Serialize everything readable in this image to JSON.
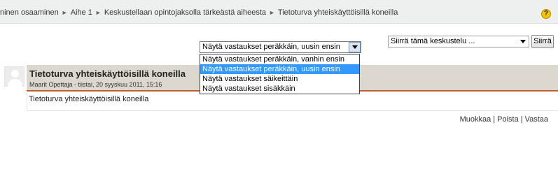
{
  "breadcrumb": {
    "items": [
      "ninen osaaminen",
      "Aihe 1",
      "Keskustellaan opintojaksolla tärkeästä aiheesta",
      "Tietoturva yhteiskäyttöisillä koneilla"
    ],
    "separator": "►"
  },
  "help_icon": "?",
  "display_mode": {
    "selected": "Näytä vastaukset peräkkäin, uusin ensin",
    "options": [
      "Näytä vastaukset peräkkäin, vanhin ensin",
      "Näytä vastaukset peräkkäin, uusin ensin",
      "Näytä vastaukset säikeittäin",
      "Näytä vastaukset sisäkkäin"
    ],
    "highlighted_index": 1
  },
  "move_discussion": {
    "selected": "Siirrä tämä keskustelu ...",
    "button_label": "Siirrä"
  },
  "post": {
    "title": "Tietoturva yhteiskäyttöisillä koneilla",
    "author": "Maarit Opettaja",
    "meta_separator": " - ",
    "date": "tiistai, 20 syyskuu 2011, 15:16",
    "message": "Tietoturva yhteiskäyttöisillä koneilla",
    "actions": [
      "Muokkaa",
      "Poista",
      "Vastaa"
    ]
  },
  "colors": {
    "topbar": "#eef0ef",
    "post_header": "#dcd8cf",
    "accent_line": "#c35a2a",
    "highlight": "#3399ff"
  }
}
